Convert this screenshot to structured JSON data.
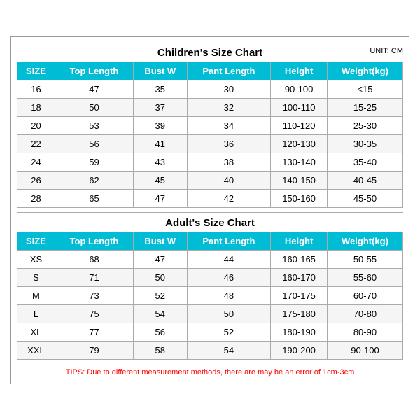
{
  "page": {
    "children_title": "Children's Size Chart",
    "adult_title": "Adult's Size Chart",
    "unit_label": "UNIT: CM",
    "headers": [
      "SIZE",
      "Top Length",
      "Bust W",
      "Pant Length",
      "Height",
      "Weight(kg)"
    ],
    "children_rows": [
      [
        "16",
        "47",
        "35",
        "30",
        "90-100",
        "<15"
      ],
      [
        "18",
        "50",
        "37",
        "32",
        "100-110",
        "15-25"
      ],
      [
        "20",
        "53",
        "39",
        "34",
        "110-120",
        "25-30"
      ],
      [
        "22",
        "56",
        "41",
        "36",
        "120-130",
        "30-35"
      ],
      [
        "24",
        "59",
        "43",
        "38",
        "130-140",
        "35-40"
      ],
      [
        "26",
        "62",
        "45",
        "40",
        "140-150",
        "40-45"
      ],
      [
        "28",
        "65",
        "47",
        "42",
        "150-160",
        "45-50"
      ]
    ],
    "adult_rows": [
      [
        "XS",
        "68",
        "47",
        "44",
        "160-165",
        "50-55"
      ],
      [
        "S",
        "71",
        "50",
        "46",
        "160-170",
        "55-60"
      ],
      [
        "M",
        "73",
        "52",
        "48",
        "170-175",
        "60-70"
      ],
      [
        "L",
        "75",
        "54",
        "50",
        "175-180",
        "70-80"
      ],
      [
        "XL",
        "77",
        "56",
        "52",
        "180-190",
        "80-90"
      ],
      [
        "XXL",
        "79",
        "58",
        "54",
        "190-200",
        "90-100"
      ]
    ],
    "tips": "TIPS: Due to different measurement methods, there are may be an error of 1cm-3cm"
  }
}
